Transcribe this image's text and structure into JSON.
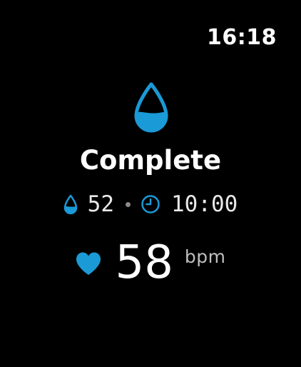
{
  "status_bar": {
    "time": "16:18"
  },
  "workout": {
    "icon": "water-drop-icon",
    "title": "Complete",
    "accent_color": "#1a9ad6"
  },
  "stats": {
    "drop_icon": "water-drop-icon",
    "count": "52",
    "separator_icon": "dot",
    "clock_icon": "clock-icon",
    "duration": "10:00"
  },
  "heart_rate": {
    "icon": "heart-icon",
    "value": "58",
    "unit": "bpm"
  }
}
